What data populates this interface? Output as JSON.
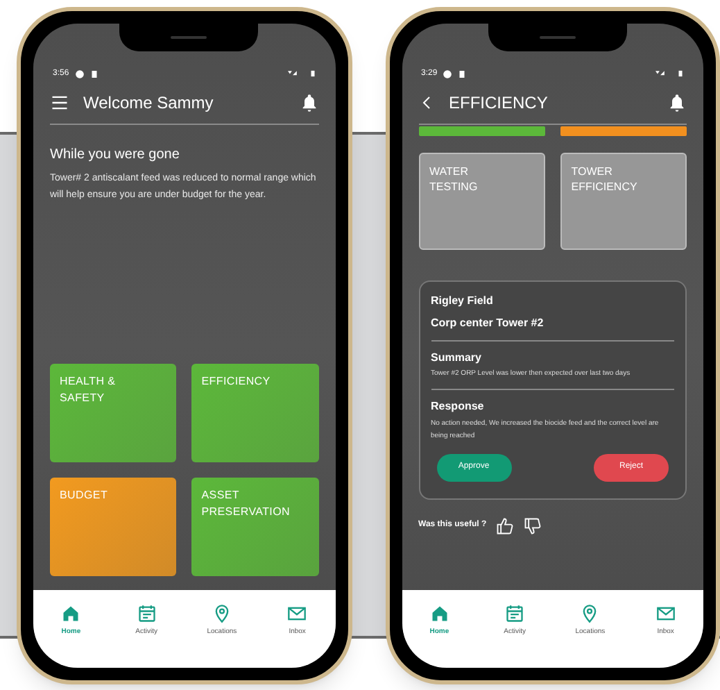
{
  "phones": [
    {
      "kind": "home",
      "status_time": "3:56",
      "header": {
        "title": "Welcome Sammy",
        "kind": "menu"
      },
      "notice": {
        "title": "While you were gone",
        "body": "Tower# 2 antiscalant feed was reduced to normal range which will help ensure you are under budget for the year."
      },
      "tiles": [
        {
          "label": "HEALTH & SAFETY",
          "color": "#5cb83a"
        },
        {
          "label": "EFFICIENCY",
          "color": "#5cb83a"
        },
        {
          "label": "BUDGET",
          "color": "#f29a1f"
        },
        {
          "label": "ASSET PRESERVATION",
          "color": "#5cb83a"
        }
      ],
      "bottom_nav": [
        {
          "label": "Home",
          "selected": true
        },
        {
          "label": "Activity",
          "selected": false
        },
        {
          "label": "Locations",
          "selected": false
        },
        {
          "label": "Inbox",
          "selected": false
        }
      ]
    },
    {
      "kind": "detail",
      "status_time": "3:29",
      "header": {
        "title": "EFFICIENCY",
        "kind": "back"
      },
      "strips": [
        {
          "color": "#5cb83a"
        },
        {
          "color": "#f2901f"
        }
      ],
      "tiles": [
        {
          "label": "WATER TESTING"
        },
        {
          "label": "TOWER EFFICIENCY"
        }
      ],
      "card": {
        "site": "Rigley Field",
        "tower": "Corp center Tower #2",
        "summary_title": "Summary",
        "summary": "Tower #2 ORP Level was lower then expected over last two days",
        "response_title": "Response",
        "response": "No action needed, We increased the biocide feed and the correct level are being reached",
        "buttons": [
          {
            "label": "Approve",
            "kind": "approve"
          },
          {
            "label": "Reject",
            "kind": "reject"
          }
        ]
      },
      "feedback": "Was this useful ?",
      "bottom_nav": [
        {
          "label": "Home",
          "selected": true
        },
        {
          "label": "Activity",
          "selected": false
        },
        {
          "label": "Locations",
          "selected": false
        },
        {
          "label": "Inbox",
          "selected": false
        }
      ]
    }
  ]
}
